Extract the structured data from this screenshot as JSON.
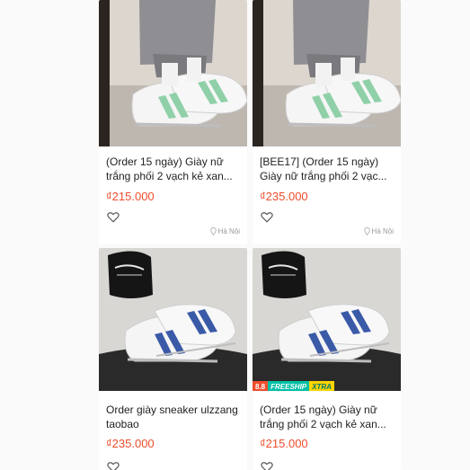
{
  "products": [
    {
      "title": "(Order 15 ngày) Giày nữ trắng phối 2 vạch kẻ xan...",
      "price": "₫215.000",
      "location": "Hà Nội"
    },
    {
      "title": "[BEE17] (Order 15 ngày) Giày nữ trắng phối 2 vạc...",
      "price": "₫235.000",
      "location": "Hà Nội"
    },
    {
      "title": "Order giày sneaker ulzzang taobao",
      "price": "₫235.000"
    },
    {
      "title": "(Order 15 ngày) Giày nữ trắng phối 2 vạch kẻ xan...",
      "price": "₫215.000"
    }
  ],
  "badge": {
    "event": "8.8",
    "freeship": "FREESHIP",
    "xtra": "XTRA"
  },
  "colors": {
    "price": "#ee4d2d",
    "stripe_green": "#8fd0a8",
    "stripe_blue": "#3a5aa8",
    "badge_teal": "#00bfa5",
    "badge_yellow": "#ffd400"
  },
  "icons": [
    "heart-outline-icon",
    "location-pin-icon"
  ]
}
